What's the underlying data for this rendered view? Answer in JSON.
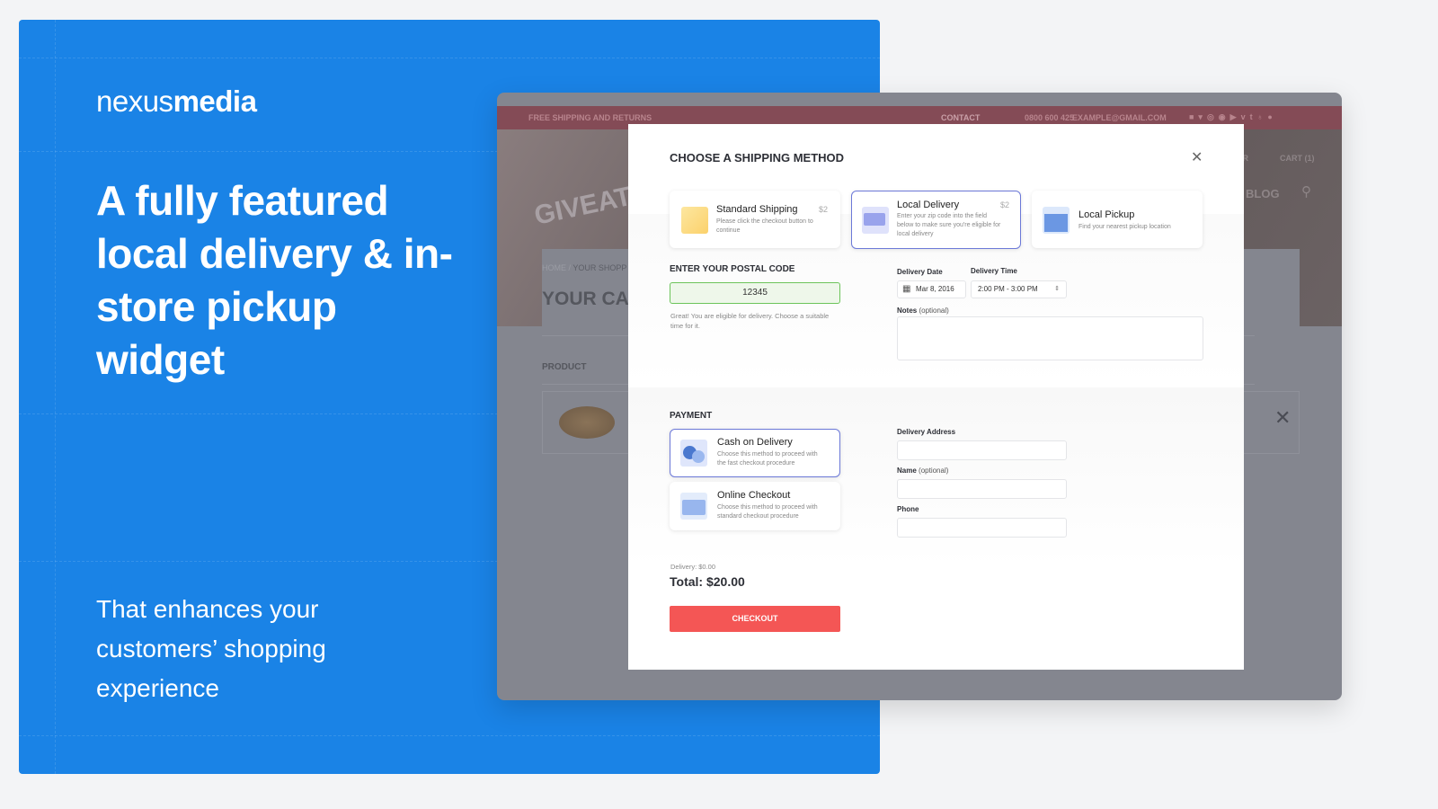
{
  "brand": {
    "logo_light": "nexus",
    "logo_bold": "media",
    "accent": "#1a83e6"
  },
  "headline": "A fully featured local delivery & in-store pickup widget",
  "subheadline": "That enhances your customers’ shopping experience",
  "store": {
    "topbar_left": "FREE SHIPPING AND RETURNS",
    "contact": "CONTACT",
    "phone": "0800 600 425",
    "email": "EXAMPLE@GMAIL.COM",
    "social_icons": [
      "facebook-icon",
      "twitter-icon",
      "instagram-icon",
      "pinterest-icon",
      "youtube-icon",
      "vimeo-icon",
      "tumblr-icon",
      "google-plus-icon",
      "location-icon"
    ],
    "nav_partial": "TER",
    "cart": "CART (1)",
    "blog": "BLOG",
    "logo_text": "GIVEATSHOP",
    "breadcrumb_home": "HOME",
    "breadcrumb_sep": "/",
    "breadcrumb_current": "YOUR SHOPP",
    "page_title": "YOUR CART",
    "product_header": "PRODUCT"
  },
  "modal": {
    "title": "CHOOSE A SHIPPING METHOD",
    "shipping_options": [
      {
        "title": "Standard Shipping",
        "desc": "Please click the checkout button to continue",
        "price": "$2",
        "icon": "box-icon",
        "selected": false
      },
      {
        "title": "Local Delivery",
        "desc": "Enter your zip code into the field below to make sure you're eligible for local delivery",
        "price": "$2",
        "icon": "truck-icon",
        "selected": true
      },
      {
        "title": "Local Pickup",
        "desc": "Find your nearest pickup location",
        "price": "",
        "icon": "store-icon",
        "selected": false
      }
    ],
    "postal_heading": "ENTER YOUR POSTAL CODE",
    "postal_value": "12345",
    "postal_message": "Great! You are eligible for delivery. Choose a suitable time for it.",
    "date_label": "Delivery Date",
    "date_value": "Mar 8, 2016",
    "time_label": "Delivery Time",
    "time_value": "2:00 PM - 3:00 PM",
    "notes_label": "Notes",
    "notes_optional": "(optional)",
    "payment_heading": "PAYMENT",
    "payment_options": [
      {
        "title": "Cash on Delivery",
        "desc": "Choose this method to proceed with the fast checkout procedure",
        "icon": "coins-icon",
        "selected": true
      },
      {
        "title": "Online Checkout",
        "desc": "Choose this method to proceed with standard checkout procedure",
        "icon": "credit-card-icon",
        "selected": false
      }
    ],
    "address_label": "Delivery Address",
    "name_label": "Name",
    "name_optional": "(optional)",
    "phone_label": "Phone",
    "delivery_fee": "Delivery: $0.00",
    "total": "Total: $20.00",
    "checkout": "CHECKOUT",
    "checkout_color": "#f45655"
  }
}
